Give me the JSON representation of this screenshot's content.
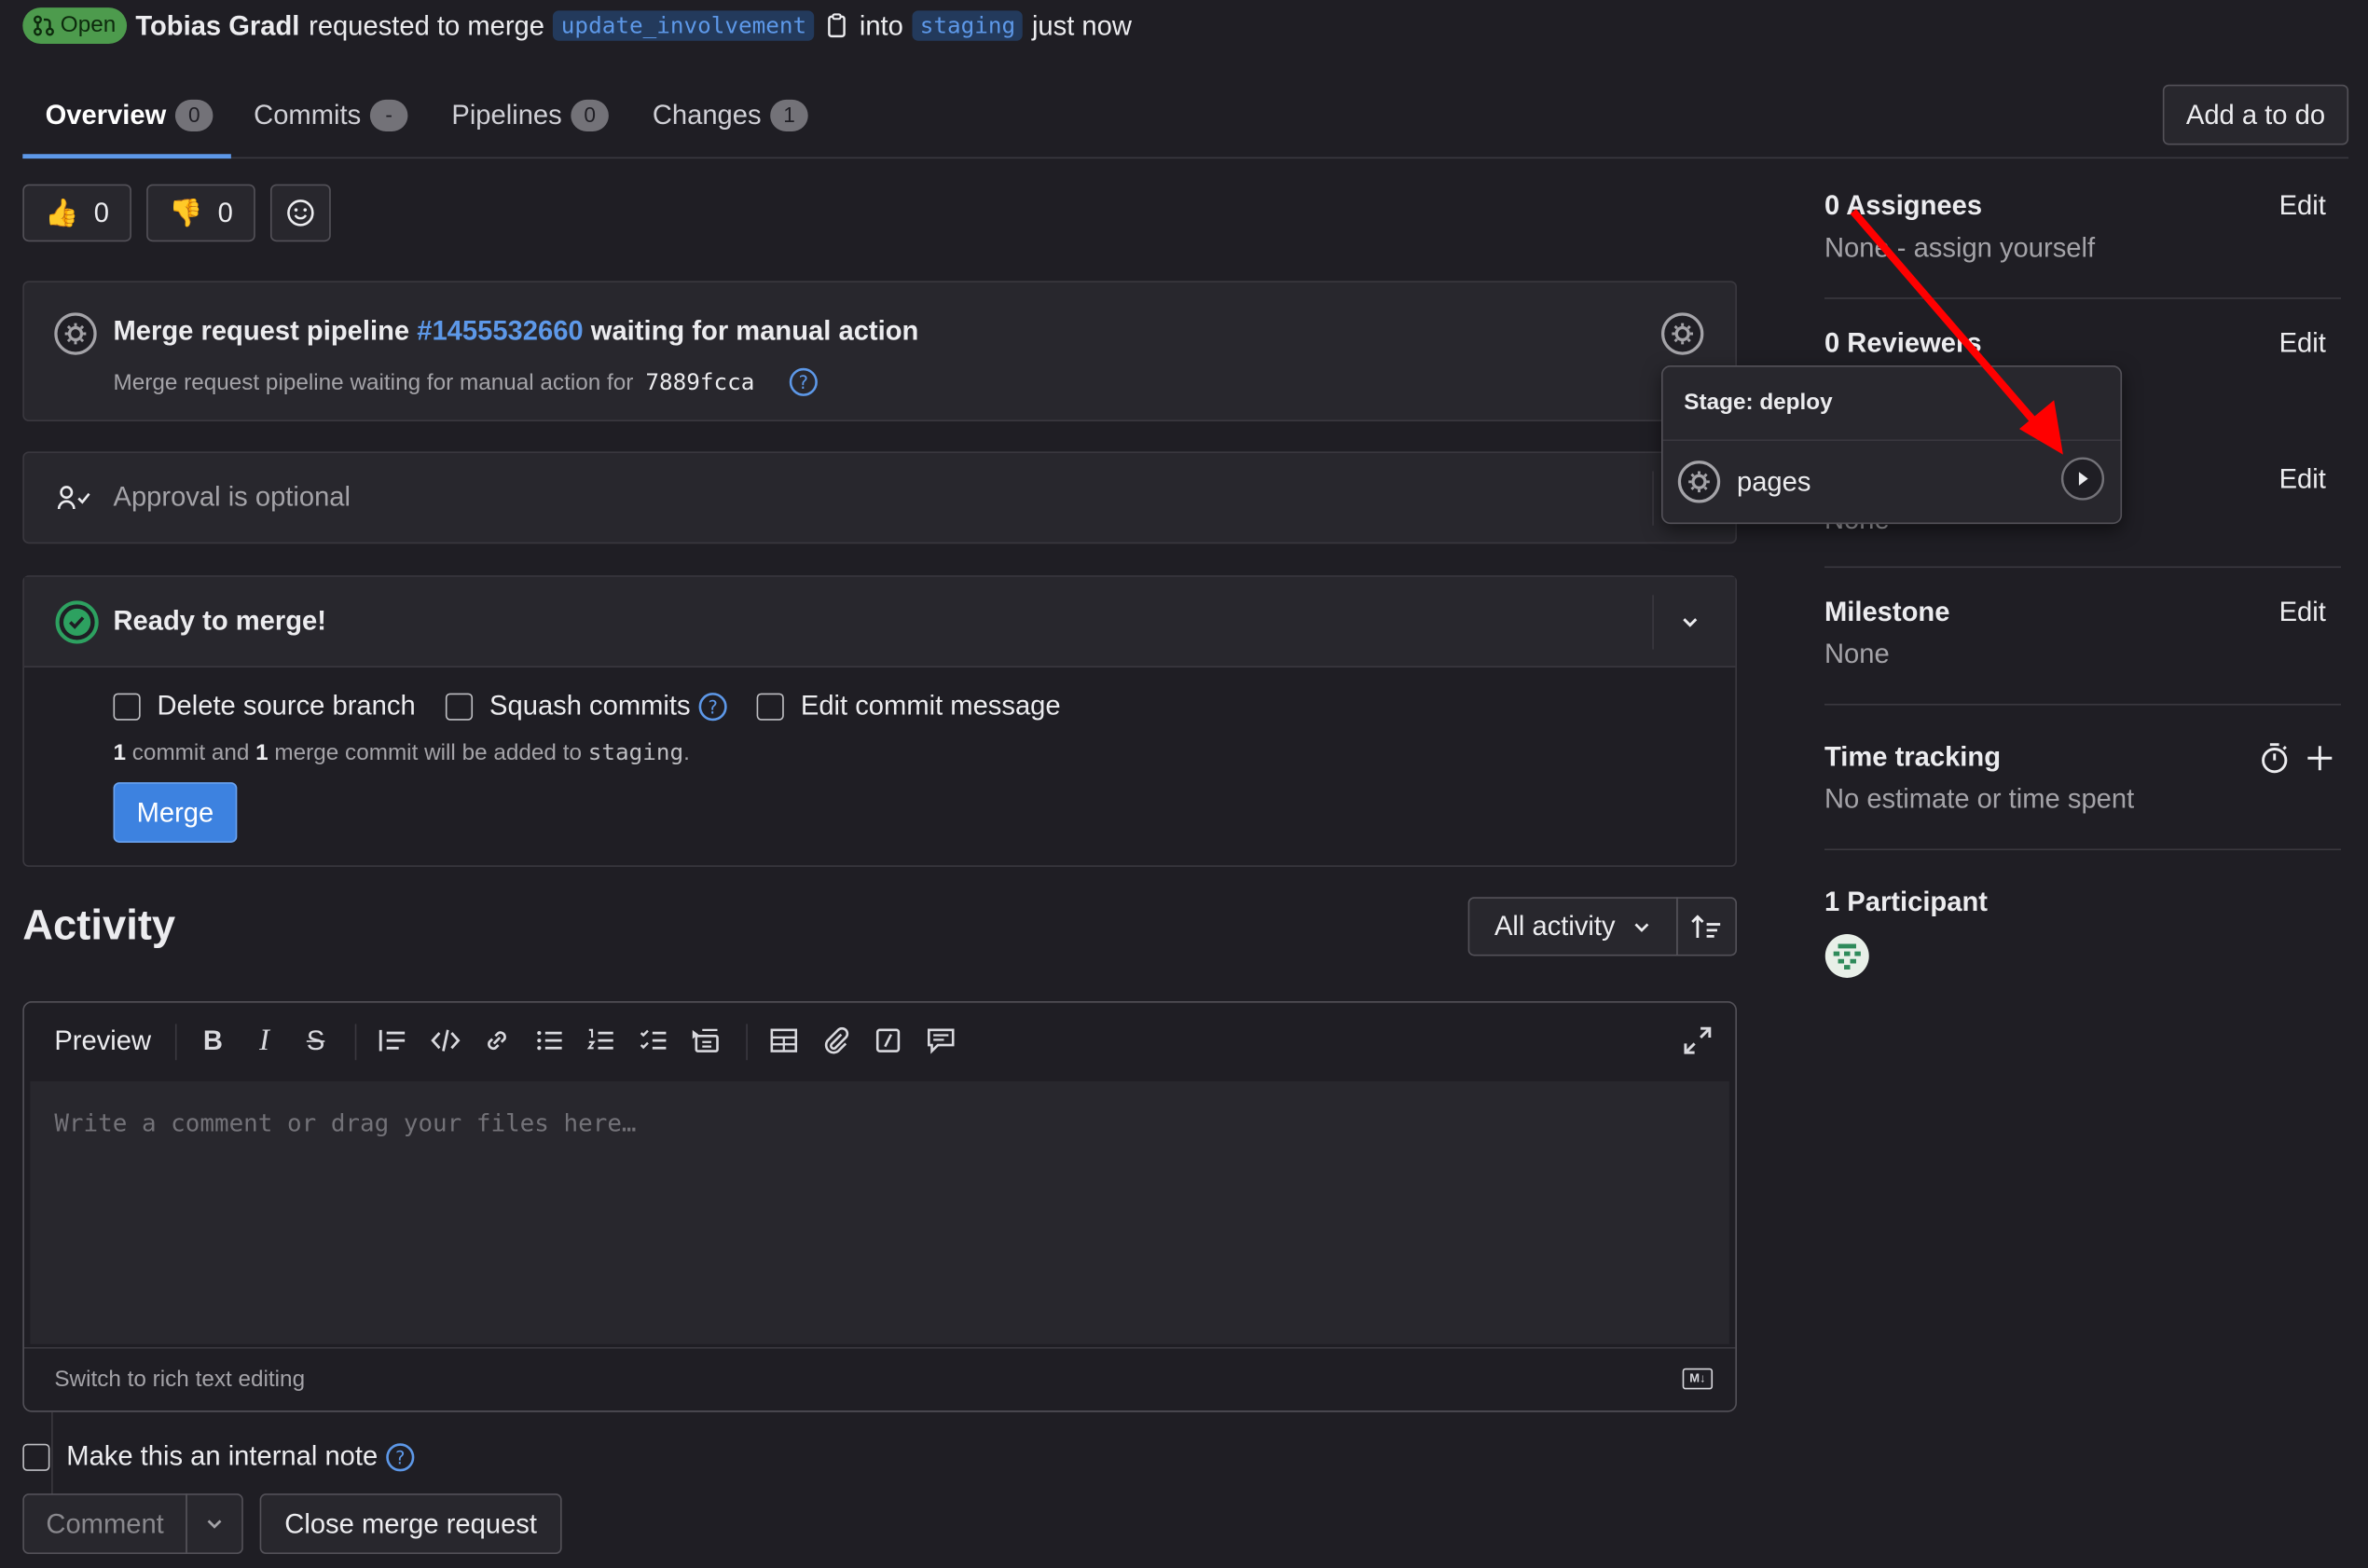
{
  "header": {
    "status": "Open",
    "author": "Tobias Gradl",
    "action": "requested to merge",
    "source_branch": "update_involvement",
    "into": "into",
    "target_branch": "staging",
    "time": "just now"
  },
  "tabs": [
    {
      "label": "Overview",
      "count": "0"
    },
    {
      "label": "Commits",
      "count": "-"
    },
    {
      "label": "Pipelines",
      "count": "0"
    },
    {
      "label": "Changes",
      "count": "1"
    }
  ],
  "todo_button": "Add a to do",
  "reactions": {
    "thumbs_up": "0",
    "thumbs_down": "0"
  },
  "pipeline": {
    "title_prefix": "Merge request pipeline",
    "id": "#1455532660",
    "title_suffix": "waiting for manual action",
    "subtitle": "Merge request pipeline waiting for manual action for",
    "sha": "7889fcca"
  },
  "popover": {
    "stage": "Stage: deploy",
    "job": "pages"
  },
  "approval": {
    "text": "Approval is optional"
  },
  "merge": {
    "title": "Ready to merge!",
    "delete_source": "Delete source branch",
    "squash": "Squash commits",
    "edit_message": "Edit commit message",
    "summary_num1": "1",
    "summary_t1": "commit and",
    "summary_num2": "1",
    "summary_t2": "merge commit will be added to",
    "summary_branch": "staging",
    "summary_end": ".",
    "button": "Merge"
  },
  "activity": {
    "title": "Activity",
    "filter": "All activity"
  },
  "editor": {
    "preview": "Preview",
    "placeholder": "Write a comment or drag your files here…",
    "switch": "Switch to rich text editing",
    "md_badge": "M↓"
  },
  "note": {
    "internal": "Make this an internal note",
    "comment": "Comment",
    "close": "Close merge request"
  },
  "sidebar": {
    "assignees_title": "0 Assignees",
    "assignees_value": "None - assign yourself",
    "reviewers_title": "0 Reviewers",
    "labels_value": "None",
    "milestone_title": "Milestone",
    "milestone_value": "None",
    "time_title": "Time tracking",
    "time_value": "No estimate or time spent",
    "participants_title": "1 Participant",
    "edit": "Edit"
  },
  "colors": {
    "background": "#1f1e24",
    "panel": "#28272d",
    "link": "#5d98e8",
    "success": "#2da160",
    "annotation_arrow": "#ff0000"
  }
}
